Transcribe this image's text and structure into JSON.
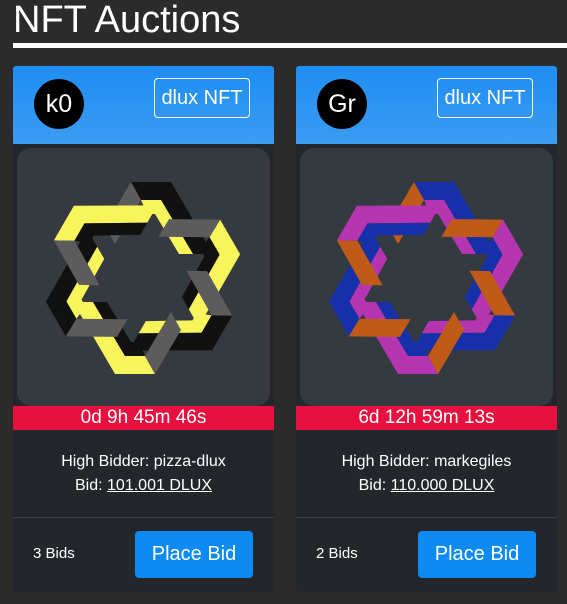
{
  "page": {
    "title": "NFT Auctions"
  },
  "auctions": [
    {
      "avatar_text": "k0",
      "type_label": "dlux NFT",
      "timer": "0d 9h 45m 46s",
      "high_bidder_label": "High Bidder:",
      "high_bidder": "pizza-dlux",
      "bid_label": "Bid:",
      "bid_amount": "101.001 DLUX",
      "bid_count": "3 Bids",
      "place_bid_label": "Place Bid",
      "art_colors": {
        "face": "#f7f45c",
        "dark": "#111111",
        "side": "#5c5c5c"
      }
    },
    {
      "avatar_text": "Gr",
      "type_label": "dlux NFT",
      "timer": "6d 12h 59m 13s",
      "high_bidder_label": "High Bidder:",
      "high_bidder": "markegiles",
      "bid_label": "Bid:",
      "bid_amount": "110.000 DLUX",
      "bid_count": "2 Bids",
      "place_bid_label": "Place Bid",
      "art_colors": {
        "face": "#b535b0",
        "dark": "#1530a8",
        "side": "#c05a18"
      }
    }
  ],
  "colors": {
    "header_blue": "#1e8df2",
    "timer_red": "#e8103e",
    "button_blue": "#0d8bf2"
  }
}
